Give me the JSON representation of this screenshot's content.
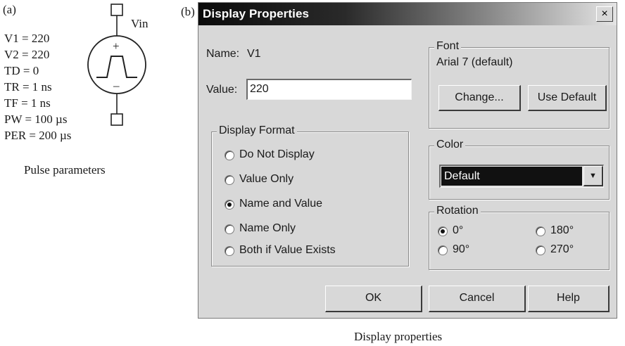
{
  "panel_a": {
    "label": "(a)",
    "source_label": "Vin",
    "parameters": [
      "V1 = 220",
      "V2 = 220",
      "TD = 0",
      "TR = 1 ns",
      "TF = 1 ns",
      "PW = 100 µs",
      "PER = 200 µs"
    ],
    "caption": "Pulse parameters",
    "symbol": {
      "plus": "+",
      "minus": "–"
    }
  },
  "panel_b": {
    "label": "(b)",
    "caption": "Display properties"
  },
  "dialog": {
    "title": "Display Properties",
    "close_glyph": "×",
    "name_label": "Name:",
    "name_value": "V1",
    "value_label": "Value:",
    "value_input": "220",
    "display_format": {
      "legend": "Display Format",
      "options": [
        "Do Not Display",
        "Value Only",
        "Name and Value",
        "Name Only",
        "Both if Value Exists"
      ],
      "selected": "Name and Value"
    },
    "font": {
      "legend": "Font",
      "current": "Arial 7 (default)",
      "change_label": "Change...",
      "use_default_label": "Use Default"
    },
    "color": {
      "legend": "Color",
      "selected": "Default",
      "dropdown_glyph": "▼"
    },
    "rotation": {
      "legend": "Rotation",
      "options": [
        "0°",
        "180°",
        "90°",
        "270°"
      ],
      "selected": "0°"
    },
    "buttons": {
      "ok": "OK",
      "cancel": "Cancel",
      "help": "Help"
    }
  },
  "colors": {
    "dialog_bg": "#d8d8d8",
    "title_gradient_start": "#0b0b0b",
    "title_gradient_end": "#e4e4e4",
    "color_field_bg": "#111111"
  }
}
